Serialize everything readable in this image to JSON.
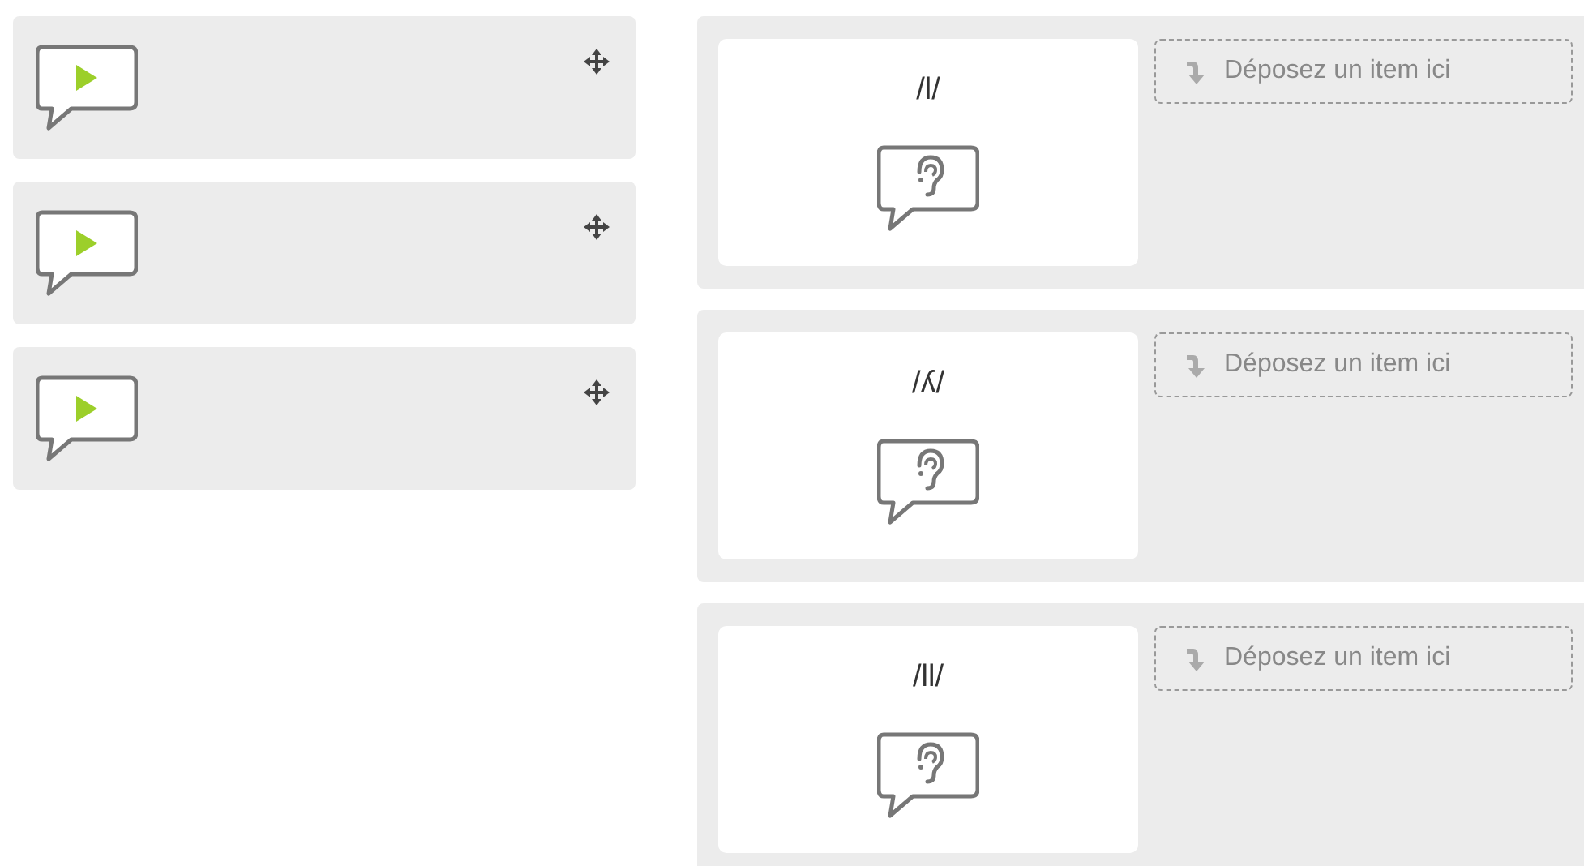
{
  "draggables": [
    {
      "kind": "audio"
    },
    {
      "kind": "audio"
    },
    {
      "kind": "audio"
    }
  ],
  "targets": [
    {
      "label": "/l/",
      "kind": "listen",
      "drop_hint": "Déposez un item ici"
    },
    {
      "label": "/ʎ/",
      "kind": "listen",
      "drop_hint": "Déposez un item ici"
    },
    {
      "label": "/ll/",
      "kind": "listen",
      "drop_hint": "Déposez un item ici"
    }
  ]
}
